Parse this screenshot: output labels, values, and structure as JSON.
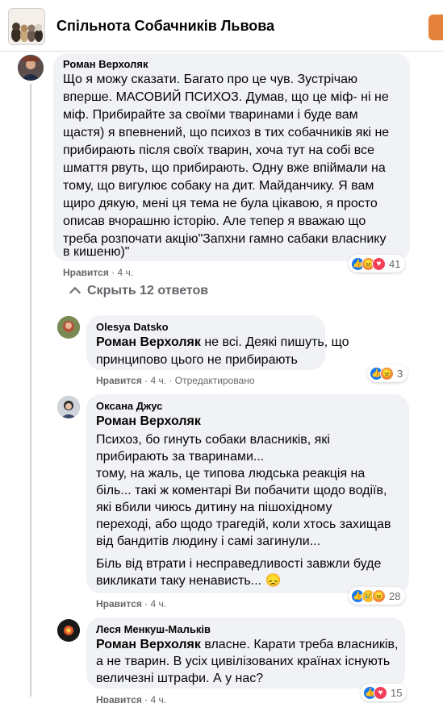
{
  "group": {
    "title": "Спільнота Собачників Львова",
    "avatar_icon": "dogs-group-photo-icon"
  },
  "comment": {
    "author": "Роман Верхоляк",
    "lines": [
      "Що я можу сказати. Багато про це чув. Зустрічаю",
      "вперше. МАСОВИЙ ПСИХОЗ. Думав, що це міф- ні не",
      "міф. Прибирайте за своїми тваринами і буде вам",
      "щастя) я впевнений, що психоз в тих собачників які не",
      "прибирають після своїх тварин, хоча тут на собі все",
      "шмаття рвуть, що прибирають. Одну вже впіймали на",
      "тому, що вигулює собаку на дит. Майданчику. Я вам",
      "щиро дякую, мені ця тема не була цікавою, я просто",
      "описав вчорашню історію. Але тепер я вважаю що",
      "треба розпочати акцію\"Запхни гамно сабаки власнику",
      "в кишеню)\""
    ],
    "like_label": "Нравится",
    "time": "4 ч.",
    "reaction_count": "41"
  },
  "replies_toggle": "Скрыть 12 ответов",
  "replies": [
    {
      "author": "Olesya Datsko",
      "mention": "Роман Верхоляк",
      "line1_rest": " не всі. Деякі пишуть, що",
      "lines": [
        "принципово цього не прибирають"
      ],
      "like_label": "Нравится",
      "time": "4 ч.",
      "edited": "Отредактировано",
      "reaction_count": "3"
    },
    {
      "author": "Оксана Джус",
      "mention": "Роман Верхоляк",
      "lines": [
        "Психоз, бо гинуть собаки власників, які",
        "прибирають за тваринами...",
        "тому, на жаль, це типова людська реакція на",
        "біль... такі ж коментарі Ви побачити щодо водіїв,",
        "які вбили чиюсь дитину на пішохідному",
        "переході, або щодо трагедій, коли хтось захищав",
        "від бандитів людину і самі загинули...",
        "",
        "Біль від втрати і несправедливості завжли буде",
        "викликати таку ненависть... 😞"
      ],
      "like_label": "Нравится",
      "time": "4 ч.",
      "reaction_count": "28"
    },
    {
      "author": "Леся Менкуш-Мальків",
      "mention": "Роман Верхоляк",
      "line1_rest": " власне. Карати треба власників,",
      "lines": [
        "а не тварин. В усіх цивілізованих країнах існують",
        "величезні штрафи. А у нас?"
      ],
      "like_label": "Нравится",
      "time": "4 ч.",
      "reaction_count": "15"
    }
  ],
  "colors": {
    "bubble": "#f0f2f5",
    "like_blue": "#1877f2",
    "meta_gray": "#65676b",
    "header_button": "#e4813b"
  }
}
